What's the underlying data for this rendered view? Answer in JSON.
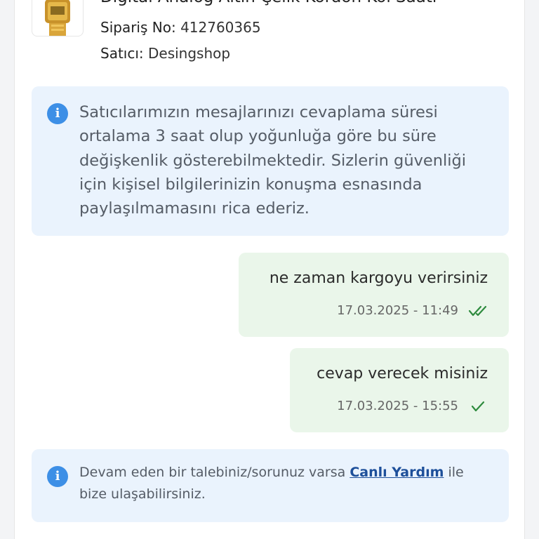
{
  "product": {
    "title": "Digital Analog Altın Çelik Kordon Kol Saati",
    "order_label": "Sipariş No:",
    "order_number": "412760365",
    "seller_label": "Satıcı:",
    "seller_name": "Desingshop"
  },
  "notice": {
    "icon": "info-icon",
    "text": "Satıcılarımızın mesajlarınızı cevaplama süresi ortalama 3 saat olup yoğunluğa göre bu süre değişkenlik gösterebilmektedir. Sizlerin güvenliği için kişisel bilgilerinizin konuşma esnasında paylaşılmamasını rica ederiz."
  },
  "messages": [
    {
      "text": "ne zaman kargoyu verirsiniz",
      "timestamp": "17.03.2025 - 11:49",
      "status": "read"
    },
    {
      "text": "cevap verecek misiniz",
      "timestamp": "17.03.2025 - 15:55",
      "status": "delivered"
    }
  ],
  "help": {
    "icon": "info-icon",
    "text_before": "Devam eden bir talebiniz/sorunuz varsa",
    "link_text": "Canlı Yardım",
    "text_after": "ile bize ulaşabilirsiniz."
  },
  "colors": {
    "info_bg": "#eaf3fd",
    "info_icon": "#3d8fe6",
    "message_bg": "#eaf6ea",
    "tick": "#2e8b3e",
    "link": "#1d4f9a"
  }
}
